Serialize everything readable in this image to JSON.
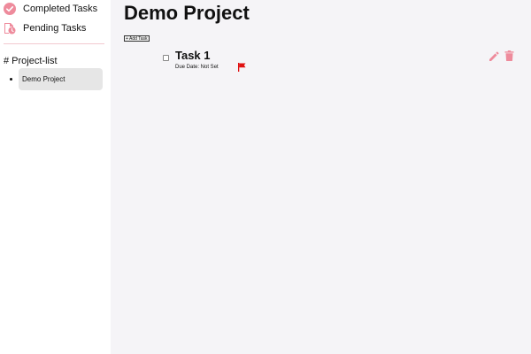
{
  "sidebar": {
    "nav": [
      {
        "label": "Completed Tasks",
        "icon": "check-circle-icon"
      },
      {
        "label": "Pending Tasks",
        "icon": "pending-clock-icon"
      }
    ],
    "section_title": "# Project-list",
    "projects": [
      {
        "label": "Demo Project",
        "selected": true
      }
    ]
  },
  "main": {
    "title": "Demo Project",
    "add_task_label": "+ Add Task",
    "tasks": [
      {
        "title": "Task 1",
        "due": "Due Date: Not Set",
        "priority_flag": "flag-icon",
        "completed": false
      }
    ]
  },
  "colors": {
    "accent": "#ee8b9c",
    "flag": "#e01010",
    "selected_bg": "#e6e6e6",
    "main_bg": "#f5f4f7"
  }
}
